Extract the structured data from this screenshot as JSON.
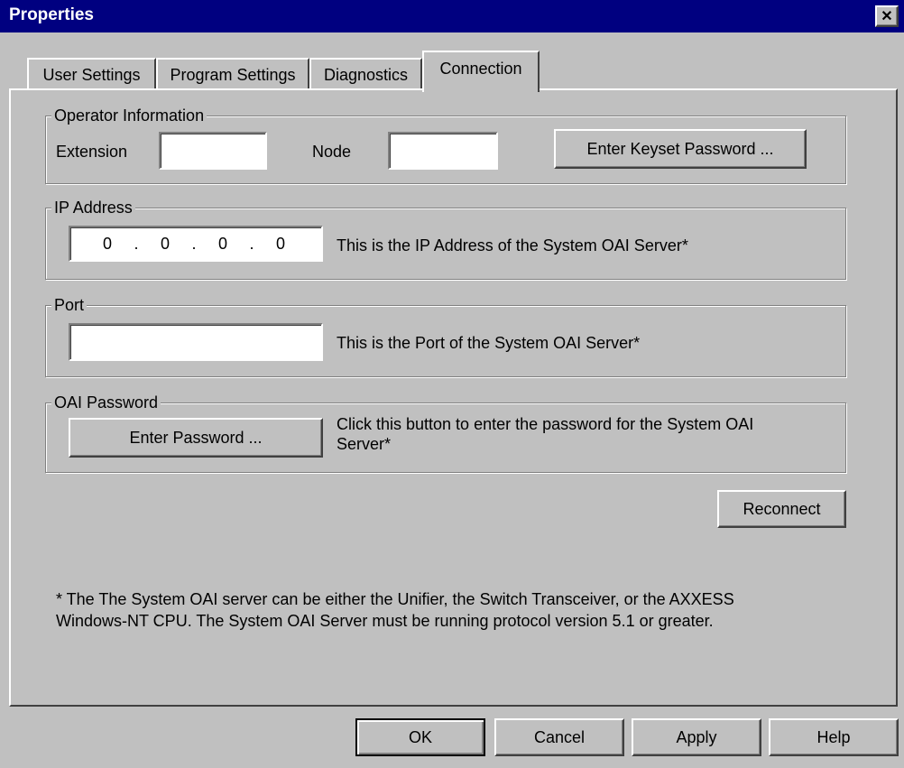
{
  "window": {
    "title": "Properties",
    "close_glyph": "✕"
  },
  "tabs": [
    {
      "label": "User Settings",
      "active": false
    },
    {
      "label": "Program Settings",
      "active": false
    },
    {
      "label": "Diagnostics",
      "active": false
    },
    {
      "label": "Connection",
      "active": true
    }
  ],
  "operator": {
    "legend": "Operator Information",
    "extension_label": "Extension",
    "extension_value": "",
    "node_label": "Node",
    "node_value": "",
    "keyset_button": "Enter Keyset Password ..."
  },
  "ip": {
    "legend": "IP Address",
    "octets": [
      "0",
      "0",
      "0",
      "0"
    ],
    "description": "This is the IP Address of the System OAI Server*"
  },
  "port": {
    "legend": "Port",
    "value": "",
    "description": "This is the Port of the System OAI Server*"
  },
  "oai": {
    "legend": "OAI Password",
    "button": "Enter Password ...",
    "description_line1": "Click this button to enter the password for the System OAI",
    "description_line2": "Server*"
  },
  "reconnect_button": "Reconnect",
  "footnote": {
    "line1": "* The The System OAI server can be either the Unifier, the Switch Transceiver, or the AXXESS",
    "line2": "Windows-NT CPU.  The System OAI Server must be running protocol version 5.1 or greater."
  },
  "buttons": {
    "ok": "OK",
    "cancel": "Cancel",
    "apply": "Apply",
    "help": "Help"
  }
}
